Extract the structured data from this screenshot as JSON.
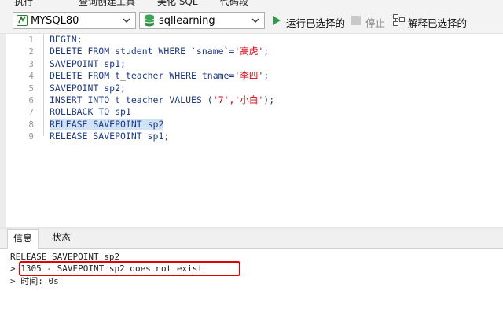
{
  "clipped_top_row": {
    "item1": "执行",
    "item2": "查询创建工具",
    "item3": "美化 SQL",
    "item4": "代码段"
  },
  "toolbar": {
    "connection": {
      "label": "MYSQL80",
      "icon": "mysql-connection-icon"
    },
    "database": {
      "label": "sqllearning",
      "icon": "database-icon"
    },
    "run_selected": {
      "label": "运行已选择的",
      "icon": "play-icon",
      "color": "#2ea043"
    },
    "stop": {
      "label": "停止",
      "icon": "stop-icon"
    },
    "explain_selected": {
      "label": "解释已选择的",
      "icon": "explain-icon"
    }
  },
  "editor": {
    "line_numbers": [
      "1",
      "2",
      "3",
      "4",
      "5",
      "6",
      "7",
      "8",
      "9"
    ],
    "lines": [
      {
        "text": "BEGIN;"
      },
      {
        "text": "DELETE FROM student WHERE `sname`=",
        "str": "'高虎'",
        "after": ";"
      },
      {
        "text": "SAVEPOINT sp1;"
      },
      {
        "text": "DELETE FROM t_teacher WHERE tname=",
        "str": "'李四'",
        "after": ";"
      },
      {
        "text": "SAVEPOINT sp2;"
      },
      {
        "text": "INSERT INTO t_teacher VALUES (",
        "str": "'7','小白'",
        "after": ");"
      },
      {
        "text": "ROLLBACK TO sp1"
      },
      {
        "text": "RELEASE SAVEPOINT sp2",
        "selected": true
      },
      {
        "text": "RELEASE SAVEPOINT sp1;"
      }
    ]
  },
  "result_tabs": [
    {
      "label": "信息",
      "active": true
    },
    {
      "label": "状态",
      "active": false
    }
  ],
  "output": {
    "statement": "RELEASE SAVEPOINT sp2",
    "error": "> 1305 - SAVEPOINT sp2 does not exist",
    "time": "> 时间: 0s"
  },
  "colors": {
    "keyword": "#1f3a8a",
    "string": "#d8000c",
    "selection": "#cfe2f6",
    "error_box": "#e00000"
  }
}
